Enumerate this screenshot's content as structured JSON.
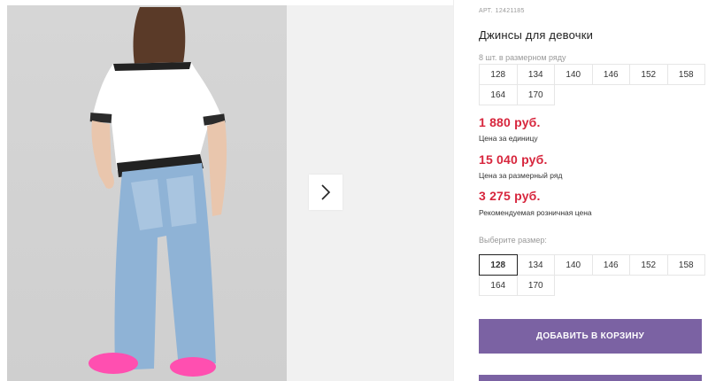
{
  "product": {
    "article_label": "АРТ.",
    "article_number": "12421185",
    "title": "Джинсы для девочки",
    "size_row_caption": "8 шт. в размерном ряду",
    "size_row": [
      "128",
      "134",
      "140",
      "146",
      "152",
      "158",
      "164",
      "170"
    ]
  },
  "prices": {
    "unit_price": "1 880 руб.",
    "unit_label": "Цена за единицу",
    "row_price": "15 040 руб.",
    "row_label": "Цена за размерный ряд",
    "retail_price": "3 275 руб.",
    "retail_label": "Рекомендуемая розничная цена"
  },
  "size_picker": {
    "label": "Выберите размер:",
    "sizes": [
      "128",
      "134",
      "140",
      "146",
      "152",
      "158",
      "164",
      "170"
    ],
    "selected": "128"
  },
  "actions": {
    "add_to_cart": "ДОБАВИТЬ В КОРЗИНУ"
  },
  "colors": {
    "price_red": "#d7263d",
    "button_purple": "#7b62a3"
  },
  "icons": {
    "gallery_next": "chevron-right-icon"
  }
}
